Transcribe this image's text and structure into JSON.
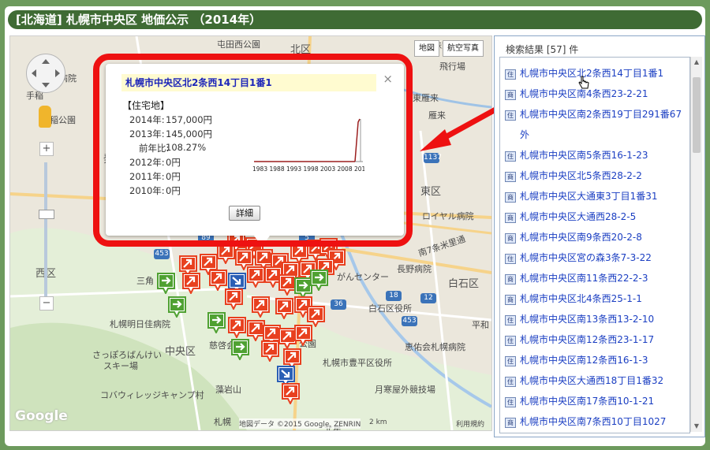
{
  "title": "[北海道] 札幌市中央区  地価公示 （2014年）",
  "map": {
    "type_buttons": [
      "地図",
      "航空写真"
    ],
    "zoom_in": "+",
    "zoom_out": "−",
    "labels": [
      {
        "text": "屯田西公園"
      },
      {
        "text": "北区"
      },
      {
        "text": "病院"
      },
      {
        "text": "手稲"
      },
      {
        "text": "稲公園"
      },
      {
        "text": "発"
      },
      {
        "text": "西区"
      },
      {
        "text": "三角"
      },
      {
        "text": "札幌明日佳病院"
      },
      {
        "text": "中央区"
      },
      {
        "text": "さっぽろばんけい"
      },
      {
        "text": "スキー場"
      },
      {
        "text": "コバウィレッジキャンプ村"
      },
      {
        "text": "藻岩山"
      },
      {
        "text": "慈啓会"
      },
      {
        "text": "札幌"
      },
      {
        "text": "丘珠空港"
      },
      {
        "text": "東雁来"
      },
      {
        "text": "雁来"
      },
      {
        "text": "飛行場"
      },
      {
        "text": "ロイヤル病院"
      },
      {
        "text": "東区"
      },
      {
        "text": "南7条米里通"
      },
      {
        "text": "長野病院"
      },
      {
        "text": "白石区"
      },
      {
        "text": "がんセンター"
      },
      {
        "text": "白石区役所"
      },
      {
        "text": "平和"
      },
      {
        "text": "恵佑会札幌病院"
      },
      {
        "text": "札幌市豊平区役所"
      },
      {
        "text": "月寒屋外競技場"
      },
      {
        "text": "公園"
      },
      {
        "text": "北星"
      }
    ],
    "shields": [
      "1137",
      "89",
      "453",
      "5",
      "18",
      "36",
      "453",
      "12"
    ],
    "attribution": "地図データ ©2015 Google, ZENRIN",
    "scale": "2 km",
    "terms": "利用規約",
    "logo": "Google"
  },
  "popup": {
    "title": "札幌市中央区北2条西14丁目1番1",
    "category": "【住宅地】",
    "rows": [
      {
        "label": "2014年:",
        "value": "157,000円"
      },
      {
        "label": "2013年:",
        "value": "145,000円"
      },
      {
        "label": "前年比:",
        "value": "108.27%"
      },
      {
        "label": "2012年:",
        "value": "0円"
      },
      {
        "label": "2011年:",
        "value": "0円"
      },
      {
        "label": "2010年:",
        "value": "0円"
      }
    ],
    "chart_years": [
      "1983",
      "1988",
      "1993",
      "1998",
      "2003",
      "2008",
      "2013"
    ],
    "detail_button": "詳細",
    "close": "×"
  },
  "results": {
    "header": "検索結果 [57] 件",
    "items": [
      {
        "type": "住",
        "text": "札幌市中央区北2条西14丁目1番1"
      },
      {
        "type": "商",
        "text": "札幌市中央区南4条西23-2-21"
      },
      {
        "type": "住",
        "text": "札幌市中央区南2条西19丁目291番67外"
      },
      {
        "type": "住",
        "text": "札幌市中央区南5条西16-1-23"
      },
      {
        "type": "商",
        "text": "札幌市中央区北5条西28-2-2"
      },
      {
        "type": "商",
        "text": "札幌市中央区大通東3丁目1番31"
      },
      {
        "type": "商",
        "text": "札幌市中央区大通西28-2-5"
      },
      {
        "type": "商",
        "text": "札幌市中央区南9条西20-2-8"
      },
      {
        "type": "住",
        "text": "札幌市中央区宮の森3条7-3-22"
      },
      {
        "type": "商",
        "text": "札幌市中央区南11条西22-2-3"
      },
      {
        "type": "商",
        "text": "札幌市中央区北4条西25-1-1"
      },
      {
        "type": "住",
        "text": "札幌市中央区南13条西13-2-10"
      },
      {
        "type": "住",
        "text": "札幌市中央区南12条西23-1-17"
      },
      {
        "type": "住",
        "text": "札幌市中央区南12条西16-1-3"
      },
      {
        "type": "住",
        "text": "札幌市中央区大通西18丁目1番32"
      },
      {
        "type": "住",
        "text": "札幌市中央区南17条西10-1-21"
      },
      {
        "type": "商",
        "text": "札幌市中央区南7条西10丁目1027"
      }
    ]
  },
  "colors": {
    "title_bg": "#3f6b34",
    "highlight": "#ee1111",
    "link": "#1a3ec2"
  }
}
